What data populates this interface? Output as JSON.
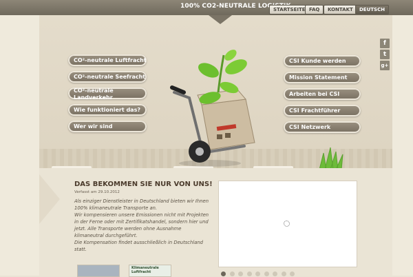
{
  "header": {
    "brand": "100% CO2-NEUTRALE LOGISTIK",
    "nav": [
      {
        "label": "STARTSEITE",
        "active": false
      },
      {
        "label": "FAQ",
        "active": false
      },
      {
        "label": "KONTAKT",
        "active": false
      },
      {
        "label": "DEUTSCH",
        "active": true
      }
    ]
  },
  "left_menu": [
    "CO²-neutrale Luftfracht",
    "CO²-neutrale Seefracht",
    "CO²-neutrale Landverkehr",
    "Wie funktioniert das?",
    "Wer wir sind"
  ],
  "right_menu": [
    "CSI Kunde werden",
    "Mission Statement",
    "Arbeiten bei CSI",
    "CSI Frachtführer",
    "CSI Netzwerk"
  ],
  "social": [
    "f",
    "t",
    "g+"
  ],
  "article": {
    "headline": "DAS BEKOMMEN SIE NUR VON UNS!",
    "date": "Verfasst am 29.10.2012",
    "paragraphs": [
      "Als einziger Dienstleister in Deutschland bieten wir Ihnen 100% klimaneutrale Transporte an.",
      "Wir kompensieren unsere Emissionen nicht mit Projekten in der Ferne oder mit Zertifikatshandel, sondern hier und jetzt. Alle Transporte werden ohne Ausnahme klimaneutral durchgeführt.",
      "Die Kompensation findet ausschließlich in Deutschland statt."
    ]
  },
  "thumbs": [
    "",
    "Klimaneutrale Luftfracht"
  ],
  "slider": {
    "count": 9,
    "active": 0
  },
  "colors": {
    "accent": "#7b7466",
    "pill": "#8a8170",
    "headline": "#4b3b2c"
  }
}
